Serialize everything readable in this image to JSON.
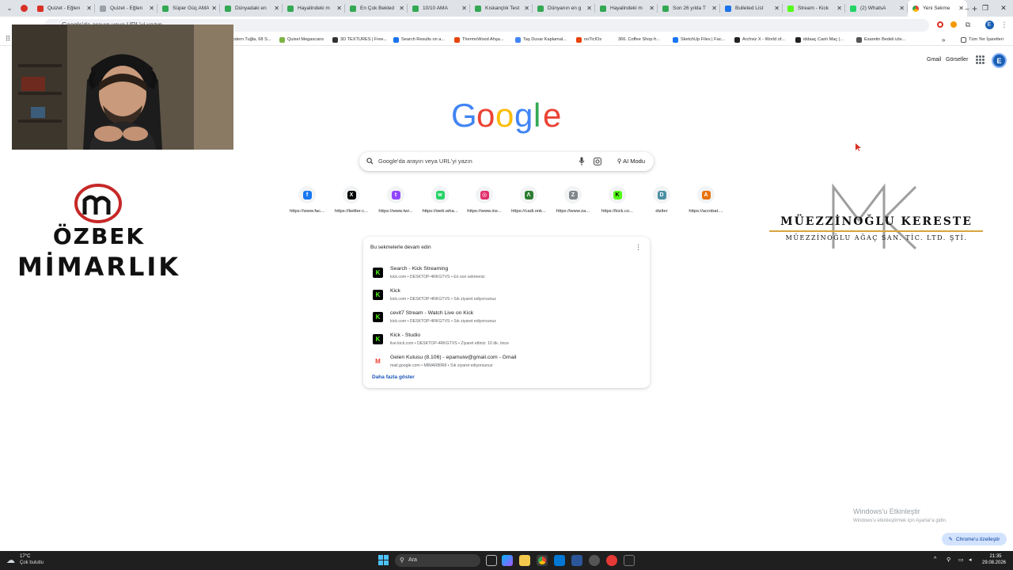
{
  "browser": {
    "tabs": [
      {
        "label": "Quizet - Eğlen",
        "color": "#d93025"
      },
      {
        "label": "Quizet - Eğlen",
        "color": "#9aa0a6"
      },
      {
        "label": "Süper Güç AMA",
        "color": "#34a853"
      },
      {
        "label": "Dünyadaki en",
        "color": "#34a853"
      },
      {
        "label": "Hayalindeki m",
        "color": "#34a853"
      },
      {
        "label": "En Çok Bekled",
        "color": "#34a853"
      },
      {
        "label": "10/10 AMA",
        "color": "#34a853"
      },
      {
        "label": "Kıskançlık Test",
        "color": "#34a853"
      },
      {
        "label": "Dünyanın en g",
        "color": "#34a853"
      },
      {
        "label": "Hayalindeki m",
        "color": "#34a853"
      },
      {
        "label": "Son 26 yılda T",
        "color": "#34a853"
      },
      {
        "label": "Bulleted List",
        "color": "#1a73e8"
      },
      {
        "label": "Stream - Kick",
        "color": "#53fc18"
      },
      {
        "label": "(2) WhatsA",
        "color": "#25d366"
      }
    ],
    "active_tab": "Yeni Sekme",
    "new_tab_symbol": "+",
    "tab_close_symbol": "✕",
    "window_controls": {
      "minimize": "–",
      "maximize": "❐",
      "close": "✕"
    },
    "omnibox_placeholder": "Google'da arayın veya URL'yi yazın",
    "account_initial": "E",
    "bookmarks": [
      {
        "label": "Modern Tuğla, 68 S...",
        "color": "#c5221f"
      },
      {
        "label": "Quixel Megascans",
        "color": "#7cb342"
      },
      {
        "label": "3D TEXTURES | Free...",
        "color": "#333333"
      },
      {
        "label": "Search Results on a...",
        "color": "#1a73e8"
      },
      {
        "label": "ThermoWood Ahşa...",
        "color": "#e8430a"
      },
      {
        "label": "Taş Duvar Kaplamal...",
        "color": "#4285f4"
      },
      {
        "label": "noTicIOs",
        "color": "#e8430a"
      },
      {
        "label": "366. Coffee Shop fr...",
        "color": "#ffffff"
      },
      {
        "label": "SketchUp Files | Fac...",
        "color": "#1877f2"
      },
      {
        "label": "Archviz X - World of...",
        "color": "#222222"
      },
      {
        "label": "iddaaç Canlı Maç |...",
        "color": "#222222"
      },
      {
        "label": "Esaretin Bedeli izle...",
        "color": "#555555"
      }
    ],
    "bookmarks_overflow": "»",
    "all_bookmarks": "Tüm Yer İşaretleri"
  },
  "ntp": {
    "top_links": [
      "Gmail",
      "Görseller"
    ],
    "logo_letters": [
      {
        "ch": "G",
        "color": "#4285f4"
      },
      {
        "ch": "o",
        "color": "#ea4335"
      },
      {
        "ch": "o",
        "color": "#fbbc05"
      },
      {
        "ch": "g",
        "color": "#4285f4"
      },
      {
        "ch": "l",
        "color": "#34a853"
      },
      {
        "ch": "e",
        "color": "#ea4335"
      }
    ],
    "search_placeholder": "Google'da arayın veya URL'yi yazın",
    "ai_mode_label": "AI Modu",
    "shortcuts": [
      {
        "label": "https://www.fac...",
        "icon": "facebook-icon",
        "glyph": "f",
        "color": "#1877f2"
      },
      {
        "label": "https://twitter.c...",
        "icon": "x-icon",
        "glyph": "X",
        "color": "#000000"
      },
      {
        "label": "https://www.twi...",
        "icon": "twitch-icon",
        "glyph": "t",
        "color": "#9146ff"
      },
      {
        "label": "https://web.wha...",
        "icon": "whatsapp-icon",
        "glyph": "w",
        "color": "#25d366"
      },
      {
        "label": "https://www.ins...",
        "icon": "instagram-icon",
        "glyph": "◎",
        "color": "#e1306c"
      },
      {
        "label": "https://cadi.onk...",
        "icon": "cadi-icon",
        "glyph": "Ʌ",
        "color": "#2e7d32"
      },
      {
        "label": "https://www.za...",
        "icon": "z-icon",
        "glyph": "Z",
        "color": "#80868b"
      },
      {
        "label": "https://kick.co...",
        "icon": "kick-icon",
        "glyph": "K",
        "color": "#53fc18"
      },
      {
        "label": "diziler",
        "icon": "d-icon",
        "glyph": "D",
        "color": "#4a90a4"
      },
      {
        "label": "https://acrobat....",
        "icon": "a-icon",
        "glyph": "A",
        "color": "#e8710a"
      }
    ],
    "resume": {
      "title": "Bu sekmelerle devam edin",
      "items": [
        {
          "title": "Search - Kick Streaming",
          "sub": "kick.com • DESKTOP-4RKGTVS • En son sekmeniz",
          "icon": "kick-icon",
          "glyph": "K",
          "color": "#53fc18"
        },
        {
          "title": "Kick",
          "sub": "kick.com • DESKTOP-4RKGTVS • Sık ziyaret ediyorsunuz",
          "icon": "kick-icon",
          "glyph": "K",
          "color": "#53fc18"
        },
        {
          "title": "cevit7 Stream - Watch Live on Kick",
          "sub": "kick.com • DESKTOP-4RKGTVS • Sık ziyaret ediyorsunuz",
          "icon": "kick-icon",
          "glyph": "K",
          "color": "#53fc18"
        },
        {
          "title": "Kick - Studio",
          "sub": "live.kick.com • DESKTOP-4RKGTVS • Ziyaret ettiniz: 10 dk. önce",
          "icon": "kick-icon",
          "glyph": "K",
          "color": "#53fc18"
        },
        {
          "title": "Gelen Kutusu (8.106) - epamuiw@gmail.com - Gmail",
          "sub": "mail.google.com • MİMARBİR8 • Sık ziyaret ediyorsunuz",
          "icon": "gmail-icon",
          "glyph": "M",
          "color": "#ea4335"
        }
      ],
      "show_more": "Daha fazla göster"
    },
    "customize_label": "Chrome'u özelleştir"
  },
  "overlays": {
    "ozbek_line1": "ÖZBEK",
    "ozbek_line2": "MİMARLIK",
    "muez_line1": "MÜEZZİNOĞLU KERESTE",
    "muez_line2": "MÜEZZİNOĞLU AĞAÇ SAN. TİC. LTD. ŞTİ.",
    "windows_activation_title": "Windows'u Etkinleştir",
    "windows_activation_sub": "Windows'u etkinleştirmek için Ayarlar'a gidin."
  },
  "taskbar": {
    "temperature": "17°C",
    "weather": "Çok bulutlu",
    "search_label": "Ara",
    "time": "21:35",
    "date": "29.08.2026"
  }
}
